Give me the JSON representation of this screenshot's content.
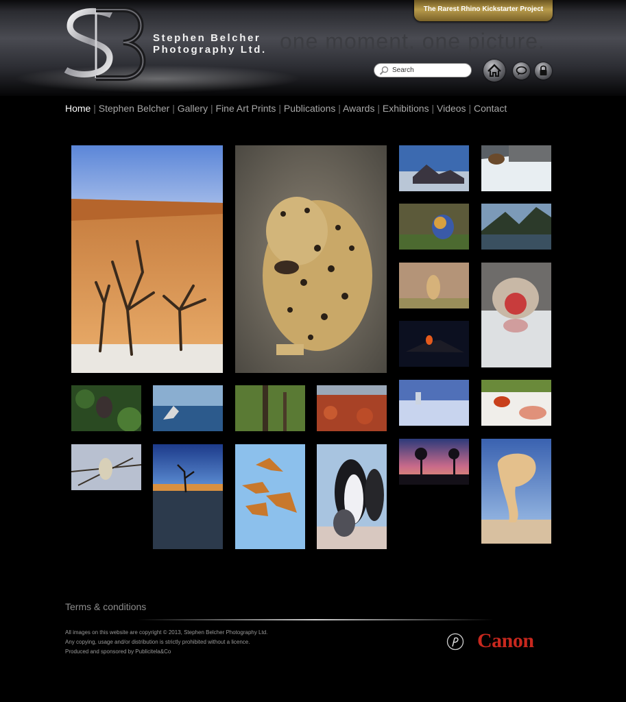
{
  "header": {
    "brand_line1": "Stephen Belcher",
    "brand_line2": "Photography Ltd.",
    "tagline": "one moment. one picture.",
    "kickstarter_label": "The Rarest Rhino Kickstarter Project",
    "search_placeholder": "Search",
    "icons": [
      "home-icon",
      "chat-icon",
      "lock-icon"
    ]
  },
  "nav": {
    "items": [
      "Home",
      "Stephen Belcher",
      "Gallery",
      "Fine Art Prints",
      "Publications",
      "Awards",
      "Exhibitions",
      "Videos",
      "Contact"
    ],
    "active": "Home",
    "separator": " | "
  },
  "gallery": {
    "photos": [
      "desert-dead-trees",
      "leopard",
      "volcano-landscape",
      "bear-waterfall",
      "bird-close-up",
      "mountain-lake",
      "cheetah-running",
      "snow-monkey",
      "erupting-volcano",
      "gorilla-forest",
      "shark-breaching",
      "forest-canopy",
      "red-flowers",
      "snow-desert-rock",
      "red-crab",
      "snow-monkey-tree",
      "desert-dead-tree-night",
      "flying-bats",
      "penguins",
      "quiver-trees-sunset",
      "mushroom-rock"
    ]
  },
  "footer": {
    "terms_label": "Terms & conditions",
    "copyright_line1": "All images on this website are copyright © 2013, Stephen Belcher Photography Ltd.",
    "copyright_line2": "Any copying, usage and/or distribution is strictly prohibited without a licence.",
    "copyright_line3": "Produced and sponsored by Publicitela&Co",
    "sponsor_logo": "Canon"
  },
  "colors": {
    "background": "#000000",
    "nav_text": "#a8a8a8",
    "nav_active": "#ffffff",
    "kickstarter_gold": "#b89b4b",
    "canon_red": "#c8281e"
  }
}
